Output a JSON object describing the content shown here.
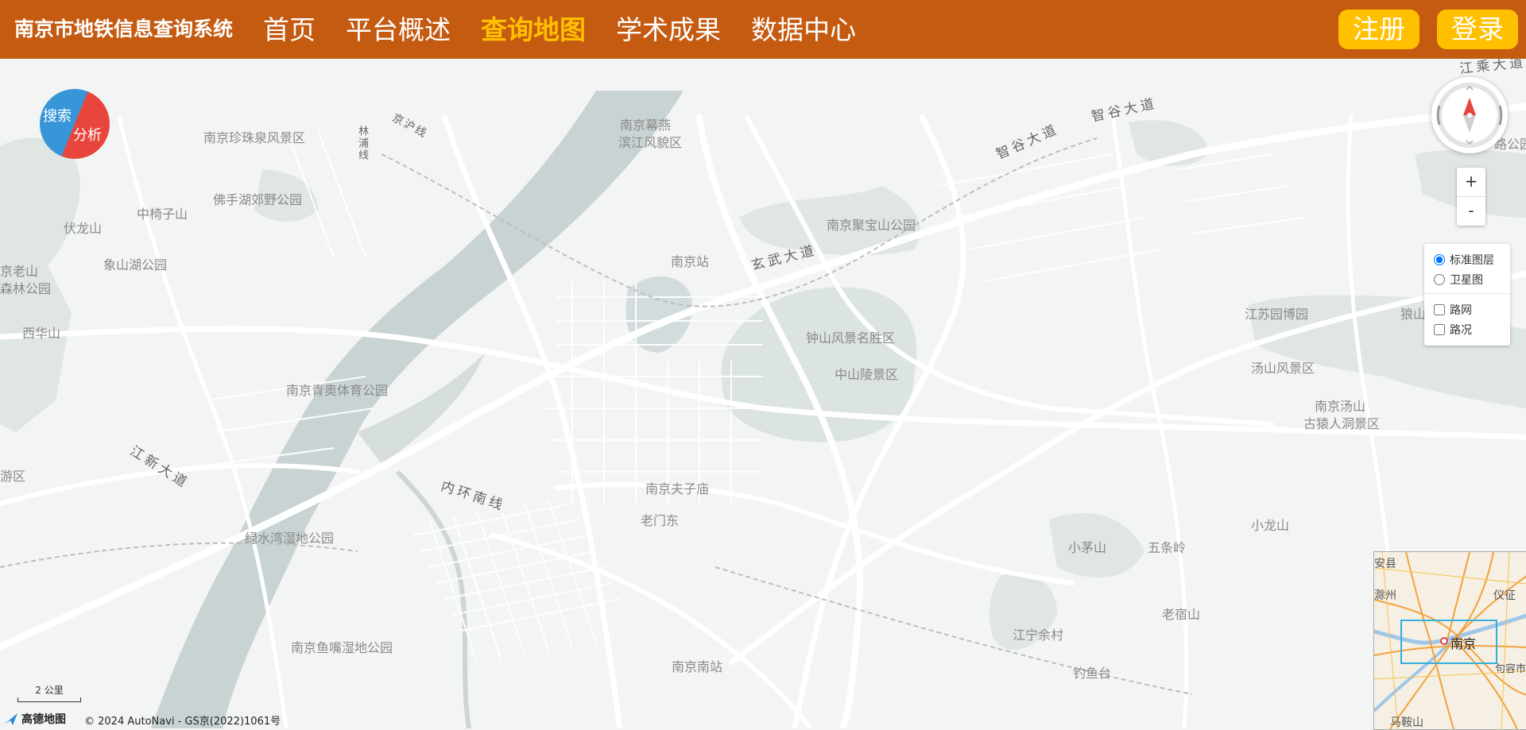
{
  "header": {
    "brand": "南京市地铁信息查询系统",
    "menu": [
      {
        "label": "首页",
        "active": false
      },
      {
        "label": "平台概述",
        "active": false
      },
      {
        "label": "查询地图",
        "active": true
      },
      {
        "label": "学术成果",
        "active": false
      },
      {
        "label": "数据中心",
        "active": false
      }
    ],
    "register_label": "注册",
    "login_label": "登录",
    "brand_color": "#c55a11",
    "accent_color": "#ffc000"
  },
  "map": {
    "search_button": {
      "search_label": "搜索",
      "analysis_label": "分析"
    },
    "zoom": {
      "in_label": "+",
      "out_label": "-"
    },
    "layers": {
      "standard": {
        "label": "标准图层",
        "checked": true
      },
      "satellite": {
        "label": "卫星图",
        "checked": false
      },
      "roadnet": {
        "label": "路网",
        "checked": false
      },
      "traffic": {
        "label": "路况",
        "checked": false
      }
    },
    "scale_label": "2 公里",
    "logo_text": "高德地图",
    "copyright": "© 2024 AutoNavi - GS京(2022)1061号",
    "place_labels": [
      "南京珍珠泉风景区",
      "南京幕燕",
      "滨江风貌区",
      "佛手湖郊野公园",
      "中椅子山",
      "伏龙山",
      "象山湖公园",
      "京老山",
      "森林公园",
      "西华山",
      "南京站",
      "南京聚宝山公园",
      "钟山风景名胜区",
      "中山陵景区",
      "南京青奥体育公园",
      "南京夫子庙",
      "老门东",
      "绿水湾湿地公园",
      "游区",
      "南京鱼嘴湿地公园",
      "南京南站",
      "江苏园博园",
      "汤山风景区",
      "南京汤山",
      "古猿人洞景区",
      "狼山",
      "小茅山",
      "五条岭",
      "小龙山",
      "老宿山",
      "江宁余村",
      "钓鱼台",
      "路公园"
    ],
    "road_labels": [
      "京沪线",
      "林浦线",
      "智谷大道",
      "智谷大道",
      "玄武大道",
      "江新大道",
      "内环南线",
      "江乘大道"
    ],
    "overview_map": {
      "labels": [
        "安县",
        "滁州",
        "仪征",
        "南京",
        "句容市",
        "马鞍山"
      ]
    }
  }
}
